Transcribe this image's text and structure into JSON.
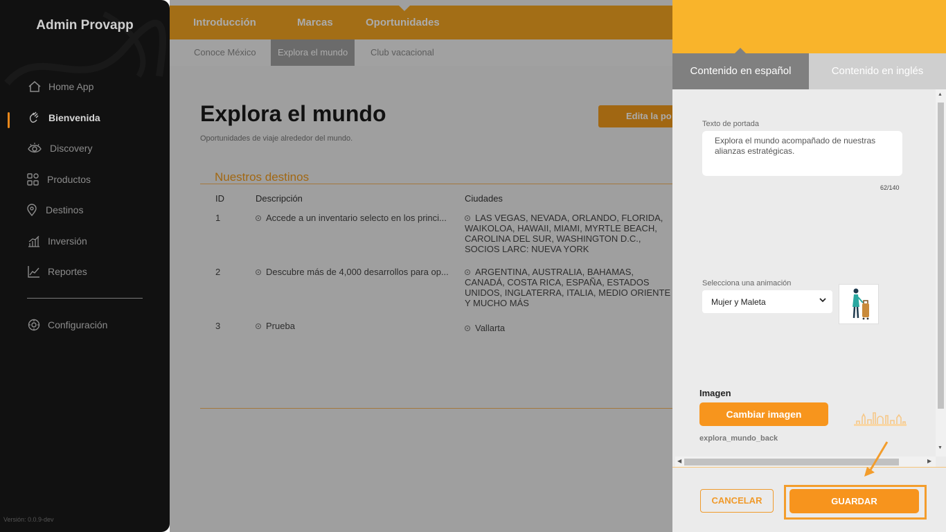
{
  "sidebar": {
    "brand": "Admin Provapp",
    "items": [
      {
        "label": "Home App",
        "icon": "home-icon"
      },
      {
        "label": "Bienvenida",
        "icon": "wave-hand-icon",
        "active": true
      },
      {
        "label": "Discovery",
        "icon": "eye-icon"
      },
      {
        "label": "Productos",
        "icon": "grid-icon"
      },
      {
        "label": "Destinos",
        "icon": "location-pin-icon"
      },
      {
        "label": "Inversión",
        "icon": "bar-chart-icon"
      },
      {
        "label": "Reportes",
        "icon": "line-chart-icon"
      }
    ],
    "settings": {
      "label": "Configuración",
      "icon": "gear-icon"
    },
    "version": "Versión: 0.0.9-dev"
  },
  "topbar": {
    "tabs": [
      "Introducción",
      "Marcas",
      "Oportunidades"
    ],
    "active_tab": "Oportunidades"
  },
  "subbar": {
    "tabs": [
      "Conoce México",
      "Explora el mundo",
      "Club vacacional"
    ],
    "active_tab": "Explora el mundo"
  },
  "page": {
    "title": "Explora el mundo",
    "subtitle": "Oportunidades de viaje alrededor del mundo.",
    "edit_button": "Edita la po"
  },
  "destinations": {
    "section_title": "Nuestros destinos",
    "columns": [
      "ID",
      "Descripción",
      "Ciudades"
    ],
    "rows": [
      {
        "id": "1",
        "description": "Accede a un inventario selecto en los princi...",
        "cities": "LAS VEGAS, NEVADA, ORLANDO, FLORIDA, WAIKOLOA, HAWAII, MIAMI, MYRTLE BEACH, CAROLINA DEL SUR, WASHINGTON D.C., SOCIOS LARC: NUEVA YORK"
      },
      {
        "id": "2",
        "description": "Descubre más de 4,000 desarrollos para op...",
        "cities": "ARGENTINA, AUSTRALIA, BAHAMAS, CANADÁ, COSTA RICA, ESPAÑA, ESTADOS UNIDOS, INGLATERRA, ITALIA, MEDIO ORIENTE Y MUCHO MÁS"
      },
      {
        "id": "3",
        "description": "Prueba",
        "cities": "Vallarta"
      }
    ]
  },
  "drawer": {
    "tabs": [
      "Contenido en español",
      "Contenido en inglés"
    ],
    "active_tab": "Contenido en español",
    "cover_text": {
      "label": "Texto de portada",
      "value": "Explora el mundo acompañado de nuestras alianzas estratégicas.",
      "counter": "62/140"
    },
    "animation": {
      "label": "Selecciona una animación",
      "selected": "Mujer y Maleta"
    },
    "image": {
      "label": "Imagen",
      "change_button": "Cambiar imagen",
      "filename": "explora_mundo_back"
    },
    "cancel_button": "CANCELAR",
    "save_button": "GUARDAR"
  },
  "colors": {
    "accent": "#f7941d",
    "header_yellow": "#f9b42b",
    "sidebar_bg": "#111111"
  }
}
